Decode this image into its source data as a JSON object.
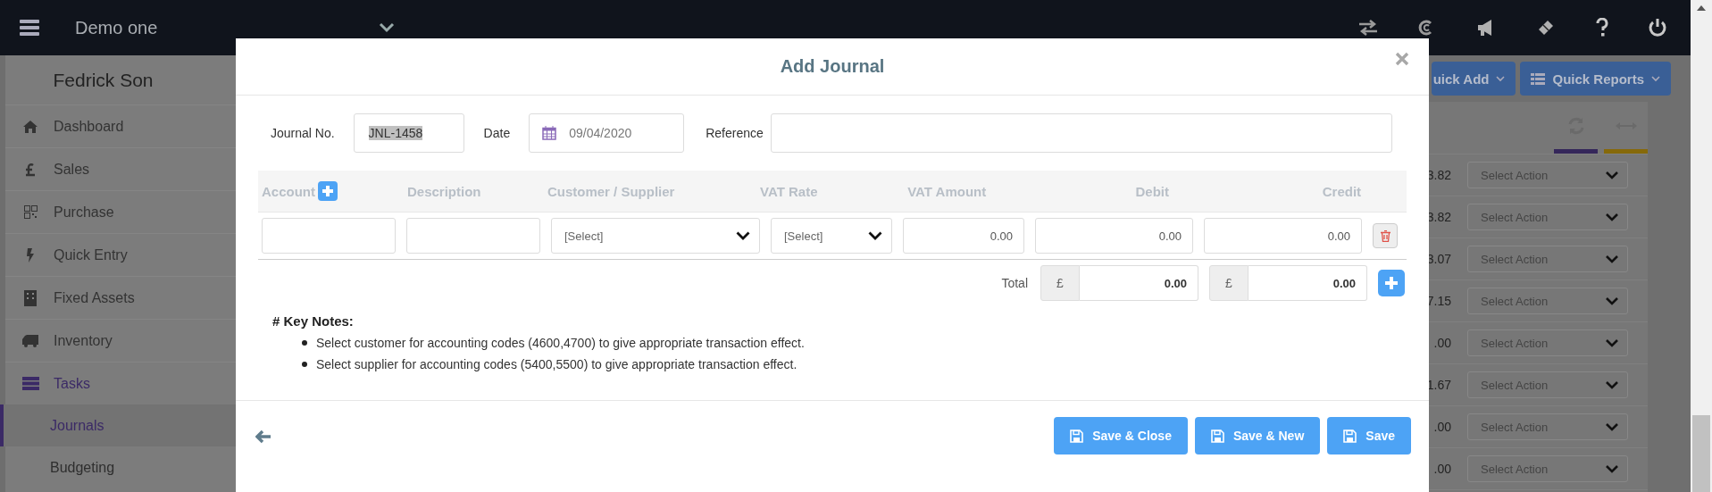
{
  "topbar": {
    "company": "Demo one"
  },
  "sidebar": {
    "user": "Fedrick Son",
    "items": [
      {
        "label": "Dashboard",
        "selected": false
      },
      {
        "label": "Sales",
        "selected": false
      },
      {
        "label": "Purchase",
        "selected": false
      },
      {
        "label": "Quick Entry",
        "selected": false
      },
      {
        "label": "Fixed Assets",
        "selected": false
      },
      {
        "label": "Inventory",
        "selected": false
      },
      {
        "label": "Tasks",
        "selected": true,
        "children": [
          {
            "label": "Journals",
            "selected": true
          },
          {
            "label": "Budgeting",
            "selected": false
          }
        ]
      }
    ]
  },
  "header_buttons": [
    {
      "label": "uick Add"
    },
    {
      "label": "Quick Reports"
    }
  ],
  "rows": [
    {
      "amount": "3.82",
      "action": "Select Action"
    },
    {
      "amount": "3.82",
      "action": "Select Action"
    },
    {
      "amount": "3.07",
      "action": "Select Action"
    },
    {
      "amount": "7.15",
      "action": "Select Action"
    },
    {
      "amount": ".00",
      "action": "Select Action"
    },
    {
      "amount": "1.67",
      "action": "Select Action"
    },
    {
      "amount": ".00",
      "action": "Select Action"
    },
    {
      "amount": ".00",
      "action": "Select Action"
    }
  ],
  "modal": {
    "title": "Add Journal",
    "journal_no": {
      "label": "Journal No.",
      "value": "JNL-1458",
      "highlighted": true
    },
    "date": {
      "label": "Date",
      "value": "09/04/2020"
    },
    "reference": {
      "label": "Reference"
    },
    "columns": [
      "Account",
      "Description",
      "Customer / Supplier",
      "VAT Rate",
      "VAT Amount",
      "Debit",
      "Credit"
    ],
    "line": {
      "customer": "[Select]",
      "vat_rate": "[Select]",
      "vat_amount": "0.00",
      "debit": "0.00",
      "credit": "0.00"
    },
    "totals": {
      "label": "Total",
      "currency": "£",
      "debit": "0.00",
      "credit": "0.00"
    },
    "notes": {
      "title": "# Key Notes:",
      "items": [
        "Select customer for accounting codes (4600,4700) to give appropriate transaction effect.",
        "Select supplier for accounting codes (5400,5500) to give appropriate transaction effect."
      ]
    },
    "buttons": [
      "Save & Close",
      "Save & New",
      "Save"
    ]
  }
}
